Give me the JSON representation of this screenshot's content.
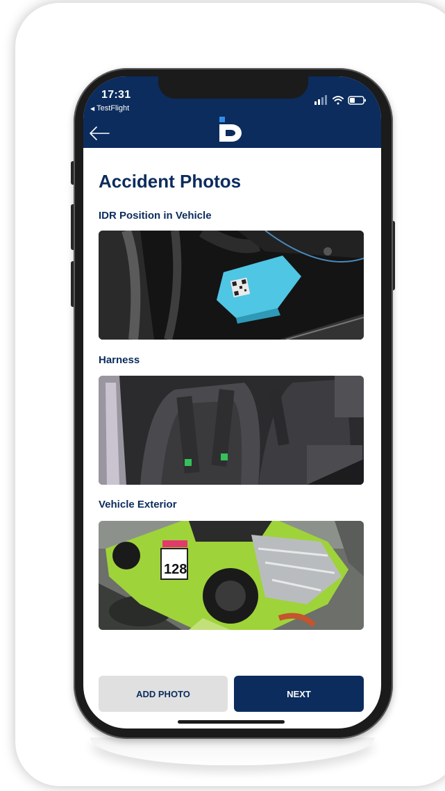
{
  "status_bar": {
    "time": "17:31",
    "back_app": "TestFlight",
    "icons": [
      "signal-icon",
      "wifi-icon",
      "battery-icon"
    ]
  },
  "nav": {
    "back_icon": "back-arrow-icon",
    "logo_icon": "id-logo-icon"
  },
  "page": {
    "title": "Accident Photos"
  },
  "sections": [
    {
      "label": "IDR Position in Vehicle",
      "image": "idr-device-photo"
    },
    {
      "label": "Harness",
      "image": "harness-seat-photo"
    },
    {
      "label": "Vehicle Exterior",
      "image": "damaged-race-car-photo"
    }
  ],
  "actions": {
    "add_photo": "ADD PHOTO",
    "next": "NEXT"
  },
  "colors": {
    "brand_navy": "#0b2c5d",
    "accent_blue": "#2f8fe8",
    "button_secondary": "#e0e0e0"
  }
}
